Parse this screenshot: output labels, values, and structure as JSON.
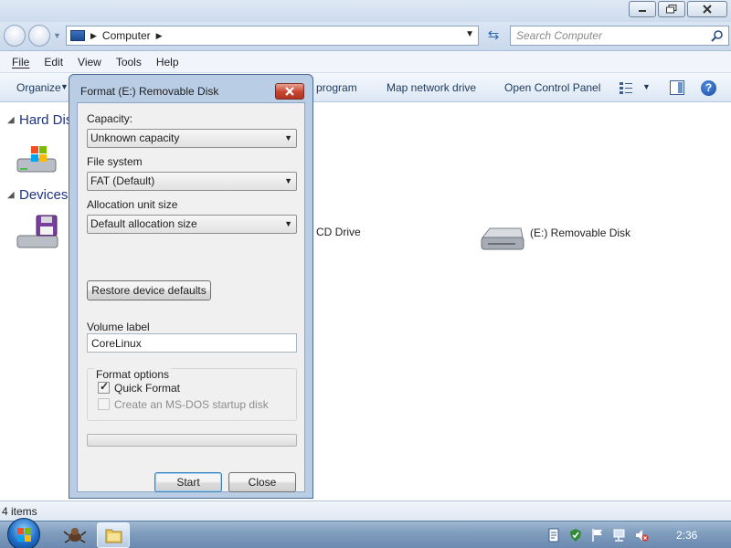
{
  "window": {
    "address": {
      "crumb": "Computer"
    },
    "search": {
      "placeholder": "Search Computer"
    },
    "menu": {
      "file": "File",
      "edit": "Edit",
      "view": "View",
      "tools": "Tools",
      "help": "Help"
    },
    "commands": {
      "organize": "Organize",
      "program": "program",
      "map_drive": "Map network drive",
      "control_panel": "Open Control Panel"
    },
    "groups": {
      "hard_disks": "Hard Disk",
      "devices": "Devices"
    },
    "items": {
      "cd_drive": "CD Drive",
      "removable": "(E:) Removable Disk"
    },
    "status": "4 items"
  },
  "taskbar": {
    "clock": "2:36"
  },
  "dialog": {
    "title": "Format (E:) Removable Disk",
    "capacity_label": "Capacity:",
    "capacity_value": "Unknown capacity",
    "filesystem_label": "File system",
    "filesystem_value": "FAT (Default)",
    "alloc_label": "Allocation unit size",
    "alloc_value": "Default allocation size",
    "restore_button": "Restore device defaults",
    "volume_label": "Volume label",
    "volume_value": "CoreLinux",
    "options_label": "Format options",
    "quick_format": {
      "label": "Quick Format",
      "checked": true
    },
    "msdos": {
      "label": "Create an MS-DOS startup disk",
      "checked": false,
      "enabled": false
    },
    "progress": 0,
    "start_button": "Start",
    "close_button": "Close"
  },
  "colors": {
    "title_blue": "#1e3287",
    "dialog_frame": "#b9cde5",
    "close_red": "#c6432f"
  }
}
